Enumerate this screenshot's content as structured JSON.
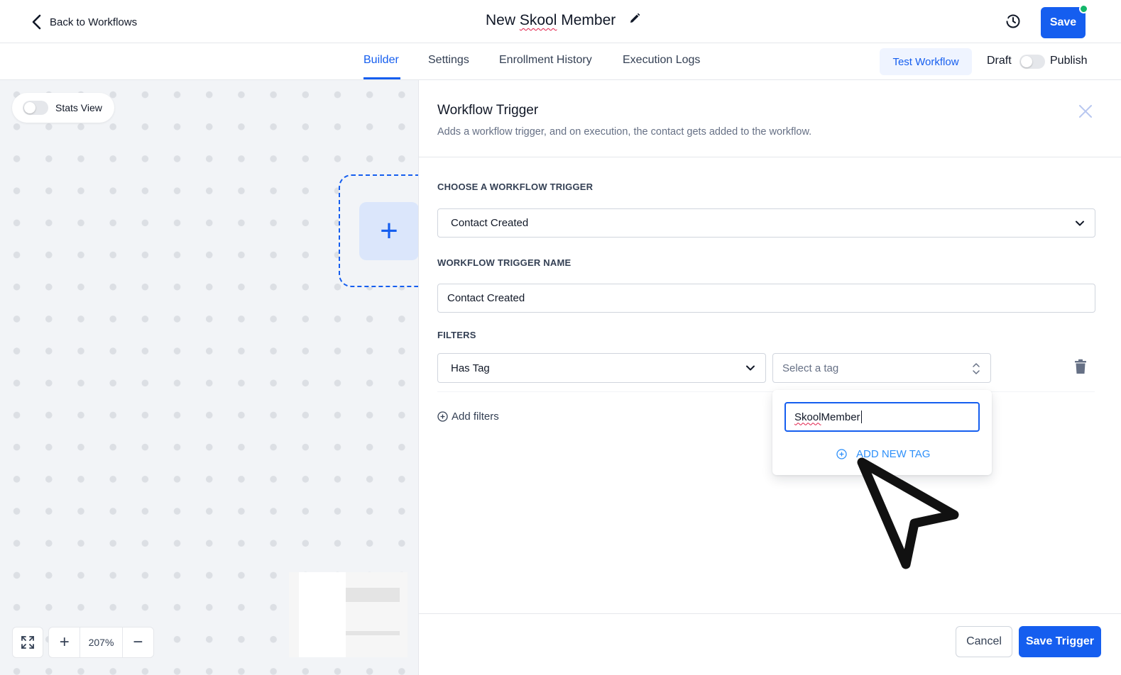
{
  "header": {
    "back_label": "Back to Workflows",
    "title_prefix": "New ",
    "title_misspelled": "Skool",
    "title_suffix": " Member",
    "save_label": "Save"
  },
  "tabs": [
    {
      "label": "Builder",
      "active": true
    },
    {
      "label": "Settings",
      "active": false
    },
    {
      "label": "Enrollment History",
      "active": false
    },
    {
      "label": "Execution Logs",
      "active": false
    }
  ],
  "toolbar": {
    "test_label": "Test Workflow",
    "draft_label": "Draft",
    "publish_label": "Publish",
    "published": false
  },
  "canvas": {
    "stats_view_label": "Stats View",
    "stats_view_on": false,
    "add_trigger_glyph": "+",
    "zoom_in_glyph": "+",
    "zoom_out_glyph": "−",
    "zoom_value": "207%"
  },
  "panel": {
    "title": "Workflow Trigger",
    "subtitle": "Adds a workflow trigger, and on execution, the contact gets added to the workflow.",
    "choose_trigger_label": "CHOOSE A WORKFLOW TRIGGER",
    "trigger_value": "Contact Created",
    "trigger_name_label": "WORKFLOW TRIGGER NAME",
    "trigger_name_value": "Contact Created",
    "filters_label": "FILTERS",
    "filter_type_value": "Has Tag",
    "tag_placeholder": "Select a tag",
    "add_filters_label": "Add filters",
    "tag_search": {
      "value_prefix": "",
      "value_misspelled": "Skool",
      "value_suffix": " Member"
    },
    "add_new_tag_label": "ADD NEW TAG",
    "cancel_label": "Cancel",
    "save_trigger_label": "Save Trigger"
  },
  "colors": {
    "primary": "#155eef",
    "status_dot": "#12b76a",
    "link_blue": "#2e90fa"
  },
  "icons": [
    "chevron-left-icon",
    "pencil-icon",
    "history-icon",
    "close-icon",
    "chevron-down-icon",
    "updown-icon",
    "trash-icon",
    "plus-circle-icon",
    "fit-screen-icon",
    "cursor-arrow-icon"
  ]
}
